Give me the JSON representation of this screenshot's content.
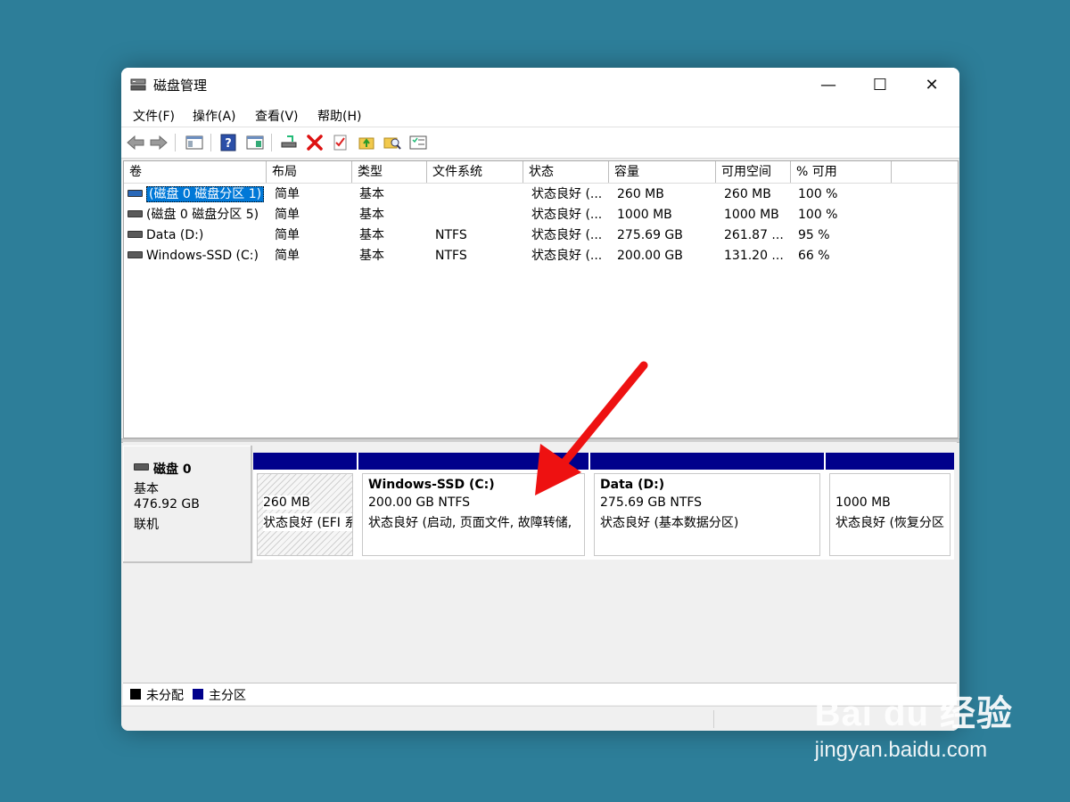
{
  "window": {
    "title": "磁盘管理",
    "minimize_glyph": "—",
    "maximize_glyph": "☐",
    "close_glyph": "✕"
  },
  "menu": [
    "文件(F)",
    "操作(A)",
    "查看(V)",
    "帮助(H)"
  ],
  "toolbar_icons": [
    "back-arrow-icon",
    "forward-arrow-icon",
    "console-view-icon",
    "help-icon",
    "show-pane-icon",
    "connect-drive-icon",
    "delete-icon",
    "checklist-icon",
    "folder-up-icon",
    "folder-search-icon",
    "properties-icon"
  ],
  "volume_table": {
    "headers": [
      "卷",
      "布局",
      "类型",
      "文件系统",
      "状态",
      "容量",
      "可用空间",
      "% 可用"
    ],
    "rows": [
      [
        "(磁盘 0 磁盘分区 1)",
        "简单",
        "基本",
        "",
        "状态良好 (...",
        "260 MB",
        "260 MB",
        "100 %"
      ],
      [
        "(磁盘 0 磁盘分区 5)",
        "简单",
        "基本",
        "",
        "状态良好 (...",
        "1000 MB",
        "1000 MB",
        "100 %"
      ],
      [
        "Data (D:)",
        "简单",
        "基本",
        "NTFS",
        "状态良好 (...",
        "275.69 GB",
        "261.87 ...",
        "95 %"
      ],
      [
        "Windows-SSD (C:)",
        "简单",
        "基本",
        "NTFS",
        "状态良好 (...",
        "200.00 GB",
        "131.20 ...",
        "66 %"
      ]
    ],
    "selected_row": 0
  },
  "disk": {
    "name": "磁盘 0",
    "type": "基本",
    "size": "476.92 GB",
    "status": "联机",
    "partitions": [
      {
        "title": "",
        "size": "260 MB",
        "status": "状态良好 (EFI 系",
        "hatched": true
      },
      {
        "title": "Windows-SSD  (C:)",
        "size": "200.00 GB NTFS",
        "status": "状态良好 (启动, 页面文件, 故障转储,",
        "hatched": false
      },
      {
        "title": "Data  (D:)",
        "size": "275.69 GB NTFS",
        "status": "状态良好 (基本数据分区)",
        "hatched": false
      },
      {
        "title": "",
        "size": "1000 MB",
        "status": "状态良好 (恢复分区",
        "hatched": false
      }
    ]
  },
  "legend": [
    {
      "label": "未分配",
      "color": "#000000"
    },
    {
      "label": "主分区",
      "color": "#00008b"
    }
  ],
  "colors": {
    "primary_partition": "#00008b",
    "selection": "#0078d7",
    "arrow": "#ee1111",
    "desktop": "#2d7e99"
  },
  "watermark": {
    "top": "Bai du 经验",
    "bottom": "jingyan.baidu.com"
  }
}
